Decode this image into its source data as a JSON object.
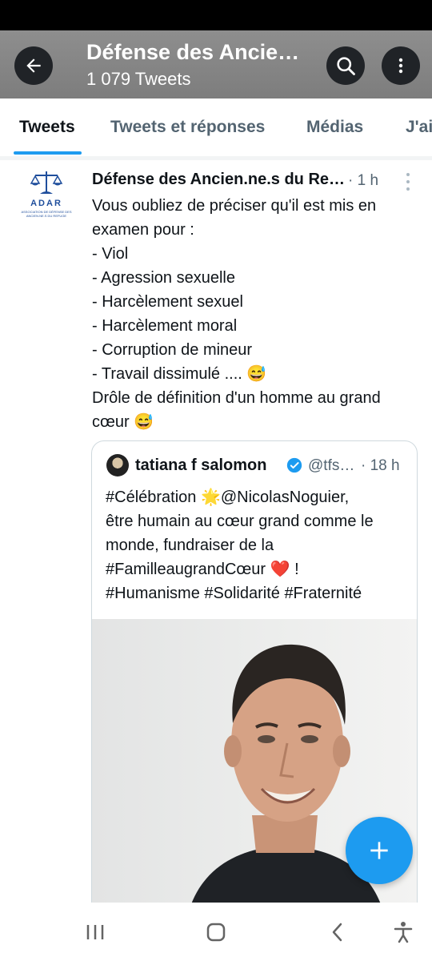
{
  "header": {
    "title": "Défense des Ancien.ne.s du Refuge",
    "tweet_count": "1 079 Tweets"
  },
  "tabs": [
    {
      "label": "Tweets"
    },
    {
      "label": "Tweets et réponses"
    },
    {
      "label": "Médias"
    },
    {
      "label": "J'aime"
    }
  ],
  "tweet": {
    "author": "Défense des Ancien.ne.s du Refuge",
    "time": "· 1 h",
    "avatar_text": "ADAR",
    "avatar_small_text": "ASSOCIATION DE DÉFENSE DES ANCIEN.NE.S DU REFUGE",
    "lines": [
      "Vous oubliez de préciser qu'il est mis en",
      "examen pour :",
      "- Viol",
      "- Agression sexuelle",
      "- Harcèlement sexuel",
      "- Harcèlement moral",
      "- Corruption de mineur",
      "- Travail dissimulé .... 😅",
      "Drôle de définition d'un homme au grand",
      "cœur 😅"
    ]
  },
  "quote": {
    "author": "tatiana f salomon",
    "handle": "@tfsalomon",
    "time": "· 18 h",
    "lines": [
      "#Célébration 🌟@NicolasNoguier,",
      "être humain au cœur grand comme le",
      "monde, fundraiser de la",
      "#FamilleaugrandCœur ❤️ !",
      "#Humanisme #Solidarité #Fraternité"
    ]
  },
  "colors": {
    "accent": "#1d9bf0",
    "header_bg": "#858585",
    "text": "#0f1419",
    "secondary_text": "#536471",
    "avatar_brand": "#1f4e9c"
  },
  "icons": {
    "back": "arrow-left-icon",
    "search": "search-icon",
    "more": "more-vertical-icon",
    "compose": "plus-icon",
    "nav_recents": "recents-icon",
    "nav_home": "home-icon",
    "nav_back": "back-chevron-icon",
    "nav_accessibility": "accessibility-icon"
  }
}
